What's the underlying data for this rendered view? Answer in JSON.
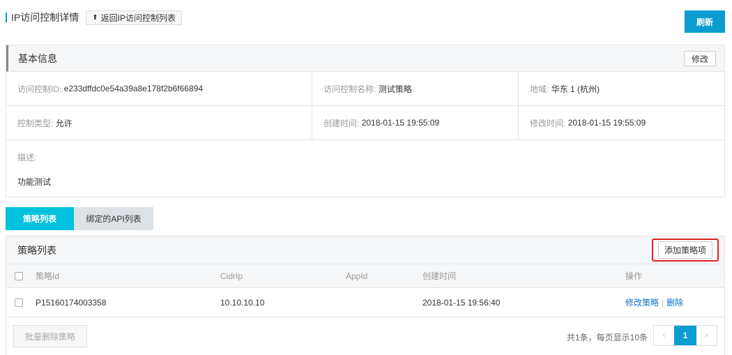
{
  "header": {
    "title": "IP访问控制详情",
    "back_label": "返回IP访问控制列表",
    "refresh_label": "刷新"
  },
  "basic_info": {
    "title": "基本信息",
    "edit_label": "修改",
    "id_label": "访问控制ID:",
    "id_value": "e233dffdc0e54a39a8e178f2b6f66894",
    "name_label": "访问控制名称:",
    "name_value": "测试策略",
    "region_label": "地域:",
    "region_value": "华东 1 (杭州)",
    "type_label": "控制类型:",
    "type_value": "允许",
    "created_label": "创建时间:",
    "created_value": "2018-01-15 19:55:09",
    "modified_label": "修改时间:",
    "modified_value": "2018-01-15 19:55:09",
    "desc_label": "描述:",
    "desc_value": "功能测试"
  },
  "tabs": [
    {
      "label": "策略列表",
      "active": true
    },
    {
      "label": "绑定的API列表",
      "active": false
    }
  ],
  "policy_list": {
    "title": "策略列表",
    "add_label": "添加策略项",
    "columns": [
      "策略Id",
      "CidrIp",
      "AppId",
      "创建时间",
      "操作"
    ],
    "rows": [
      {
        "id": "P15160174003358",
        "cidr": "10.10.10.10",
        "appid": "",
        "created": "2018-01-15 19:56:40",
        "action_edit": "修改策略",
        "action_delete": "删除"
      }
    ],
    "batch_delete_label": "批量删除策略",
    "pager_info": "共1条，每页显示10条",
    "pager_prev": "‹",
    "pager_current": "1",
    "pager_next": "›"
  },
  "colors": {
    "accent": "#00c1de",
    "primary_button": "#0b9cd0",
    "highlight_border": "#e02020",
    "link": "#0b72c4"
  }
}
